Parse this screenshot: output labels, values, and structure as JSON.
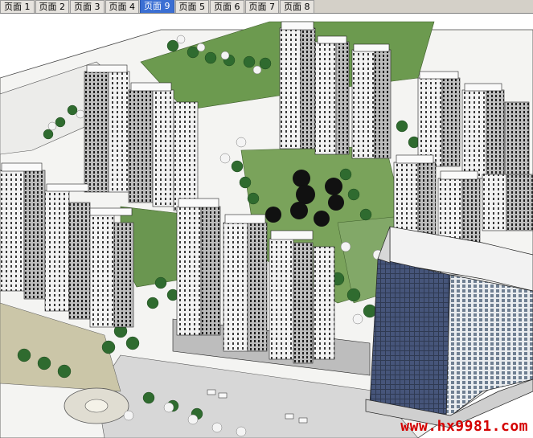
{
  "tabs": [
    {
      "label": "页面 1",
      "active": false
    },
    {
      "label": "页面 2",
      "active": false
    },
    {
      "label": "页面 3",
      "active": false
    },
    {
      "label": "页面 4",
      "active": false
    },
    {
      "label": "页面 9",
      "active": true
    },
    {
      "label": "页面 5",
      "active": false
    },
    {
      "label": "页面 6",
      "active": false
    },
    {
      "label": "页面 7",
      "active": false
    },
    {
      "label": "页面 8",
      "active": false
    }
  ],
  "watermark": "www.hx9981.com",
  "colors": {
    "active_tab": "#3b6fd3",
    "lawn": "#6c9a4f",
    "watermark": "#d40000"
  }
}
